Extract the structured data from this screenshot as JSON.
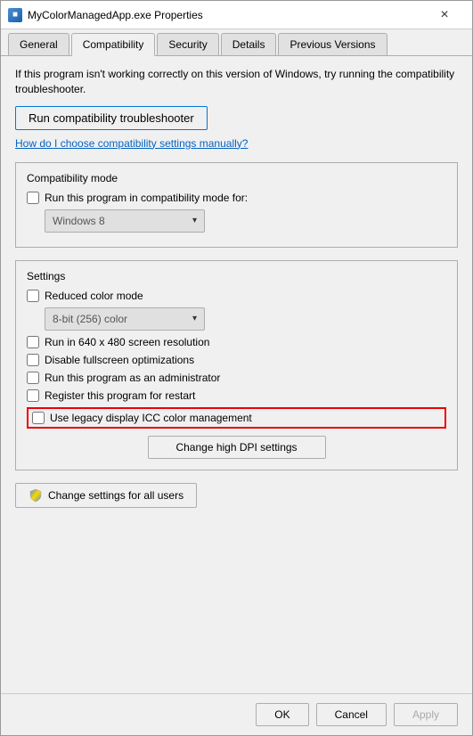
{
  "titleBar": {
    "icon": "■",
    "title": "MyColorManagedApp.exe Properties",
    "closeLabel": "×"
  },
  "tabs": [
    {
      "label": "General",
      "active": false
    },
    {
      "label": "Compatibility",
      "active": true
    },
    {
      "label": "Security",
      "active": false
    },
    {
      "label": "Details",
      "active": false
    },
    {
      "label": "Previous Versions",
      "active": false
    }
  ],
  "content": {
    "infoText": "If this program isn't working correctly on this version of Windows, try running the compatibility troubleshooter.",
    "troubleshooterBtn": "Run compatibility troubleshooter",
    "helpLink": "How do I choose compatibility settings manually?",
    "compatSection": {
      "label": "Compatibility mode",
      "checkboxLabel": "Run this program in compatibility mode for:",
      "dropdownValue": "Windows 8",
      "dropdownArrow": "▾"
    },
    "settingsSection": {
      "label": "Settings",
      "checkboxes": [
        {
          "label": "Reduced color mode",
          "checked": false
        },
        {
          "label": "Run in 640 x 480 screen resolution",
          "checked": false
        },
        {
          "label": "Disable fullscreen optimizations",
          "checked": false
        },
        {
          "label": "Run this program as an administrator",
          "checked": false
        },
        {
          "label": "Register this program for restart",
          "checked": false
        }
      ],
      "highlightedCheckbox": {
        "label": "Use legacy display ICC color management",
        "checked": false
      },
      "colorDropdownValue": "8-bit (256) color",
      "colorDropdownArrow": "▾",
      "changeDpiBtn": "Change high DPI settings"
    },
    "allUsersBtn": "Change settings for all users",
    "shieldIcon": "🛡"
  },
  "footer": {
    "okLabel": "OK",
    "cancelLabel": "Cancel",
    "applyLabel": "Apply"
  }
}
